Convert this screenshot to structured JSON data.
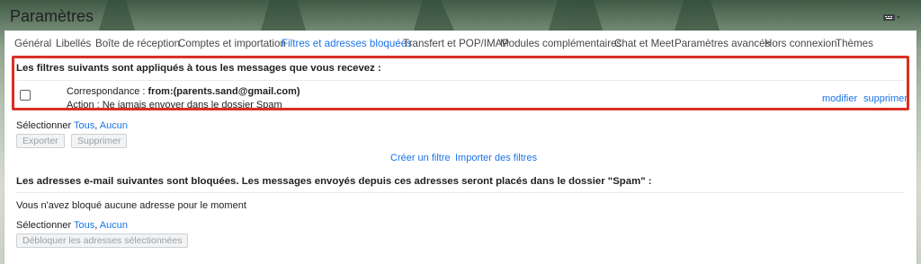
{
  "window": {
    "title": "Paramètres"
  },
  "tabs": [
    {
      "label": "Général",
      "active": false
    },
    {
      "label": "Libellés",
      "active": false
    },
    {
      "label": "Boîte de réception",
      "active": false
    },
    {
      "label": "Comptes et importation",
      "active": false
    },
    {
      "label": "Filtres et adresses bloquées",
      "active": true
    },
    {
      "label": "Transfert et POP/IMAP",
      "active": false
    },
    {
      "label": "Modules complémentaires",
      "active": false
    },
    {
      "label": "Chat et Meet",
      "active": false
    },
    {
      "label": "Paramètres avancés",
      "active": false
    },
    {
      "label": "Hors connexion",
      "active": false
    },
    {
      "label": "Thèmes",
      "active": false
    }
  ],
  "filters": {
    "heading": "Les filtres suivants sont appliqués à tous les messages que vous recevez :",
    "items": [
      {
        "match_label": "Correspondance : ",
        "match_value": "from:(parents.sand@gmail.com)",
        "action": "Action : Ne jamais envoyer dans le dossier Spam",
        "edit_label": "modifier",
        "delete_label": "supprimer",
        "checked": false
      }
    ],
    "select_label": "Sélectionner",
    "select_all": "Tous",
    "select_sep": ",",
    "select_none": "Aucun",
    "export_label": "Exporter",
    "delete_label": "Supprimer",
    "create_filter": "Créer un filtre",
    "import_filters": "Importer des filtres"
  },
  "blocked": {
    "heading": "Les adresses e-mail suivantes sont bloquées. Les messages envoyés depuis ces adresses seront placés dans le dossier \"Spam\" :",
    "empty_message": "Vous n'avez bloqué aucune adresse pour le moment",
    "select_label": "Sélectionner",
    "select_all": "Tous",
    "select_sep": ",",
    "select_none": "Aucun",
    "unblock_label": "Débloquer les adresses sélectionnées"
  },
  "colors": {
    "accent": "#1a73e8",
    "highlight": "#d93025"
  }
}
